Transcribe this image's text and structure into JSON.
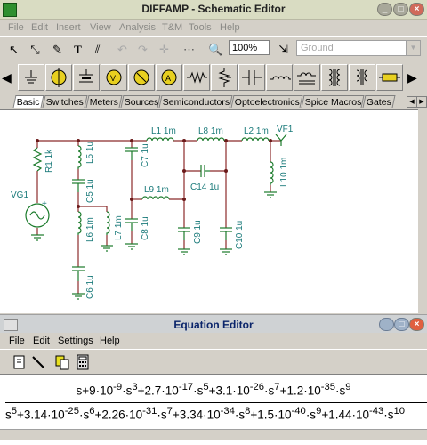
{
  "schematic_window": {
    "title": "DIFFAMP - Schematic Editor",
    "menu": [
      "File",
      "Edit",
      "Insert",
      "View",
      "Analysis",
      "T&M",
      "Tools",
      "Help"
    ],
    "zoom": "100%",
    "component_select": "Ground",
    "tabs": [
      "Basic",
      "Switches",
      "Meters",
      "Sources",
      "Semiconductors",
      "Optoelectronics",
      "Spice Macros",
      "Gates"
    ],
    "active_tab": "Basic"
  },
  "schematic": {
    "labels": {
      "R1": "R1 1k",
      "VG1": "VG1",
      "L5": "L5 1u",
      "C5": "C5 1u",
      "L6": "L6 1m",
      "L7": "L7 1m",
      "C6": "C6 1u",
      "C7": "C7 1u",
      "C8": "C8 1u",
      "L1": "L1 1m",
      "L8": "L8 1m",
      "L9": "L9 1m",
      "C14": "C14 1u",
      "C9": "C9 1u",
      "C10": "C10 1u",
      "L2": "L2 1m",
      "VF1": "VF1",
      "L10": "L10 1m",
      "plus": "+"
    }
  },
  "equation_window": {
    "title": "Equation Editor",
    "menu": [
      "File",
      "Edit",
      "Settings",
      "Help"
    ],
    "numerator": "s+9·10^-9·s^3+2.7·10^-17·s^5+3.1·10^-26·s^7+1.2·10^-35·s^9",
    "denominator": "s^5+3.14·10^-25·s^6+2.26·10^-31·s^7+3.34·10^-34·s^8+1.5·10^-40·s^9+1.44·10^-43·s^10"
  },
  "colors": {
    "wire": "#8b2a2a",
    "component": "#1a7a2a",
    "label": "#1a7a7a",
    "node": "#6b1a1a"
  }
}
